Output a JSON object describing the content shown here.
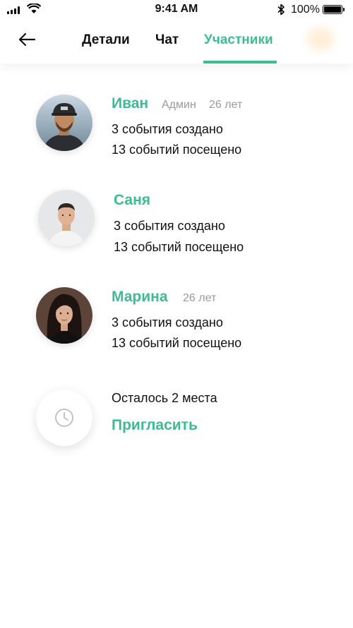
{
  "status_bar": {
    "time": "9:41 AM",
    "battery": "100%"
  },
  "nav": {
    "tabs": [
      {
        "label": "Детали"
      },
      {
        "label": "Чат"
      },
      {
        "label": "Участники",
        "active": true
      }
    ],
    "accent_color": "#3dbb93"
  },
  "members": [
    {
      "name": "Иван",
      "role": "Админ",
      "age": "26 лет",
      "created": "3 события создано",
      "attended": "13 событий посещено"
    },
    {
      "name": "Саня",
      "created": "3 события создано",
      "attended": "13 событий посещено"
    },
    {
      "name": "Марина",
      "age": "26 лет",
      "created": "3 события создано",
      "attended": "13 событий посещено"
    }
  ],
  "invite": {
    "seats_left": "Осталось 2 места",
    "invite_label": "Пригласить",
    "icon": "clock-icon"
  }
}
